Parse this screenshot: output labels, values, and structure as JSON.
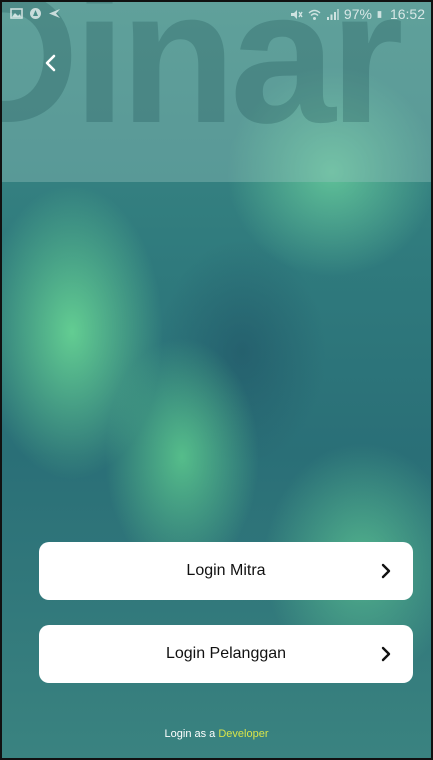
{
  "status_bar": {
    "battery": "97%",
    "time": "16:52"
  },
  "watermark": {
    "text": "Dinar"
  },
  "buttons": [
    {
      "label": "Login Mitra"
    },
    {
      "label": "Login Pelanggan"
    }
  ],
  "developer": {
    "prefix": "Login as a",
    "link": "Developer"
  },
  "colors": {
    "link_accent": "#d8e44a",
    "button_bg": "#ffffff"
  },
  "icons": {
    "back": "chevron-left-icon",
    "button_arrow": "chevron-right-icon"
  }
}
